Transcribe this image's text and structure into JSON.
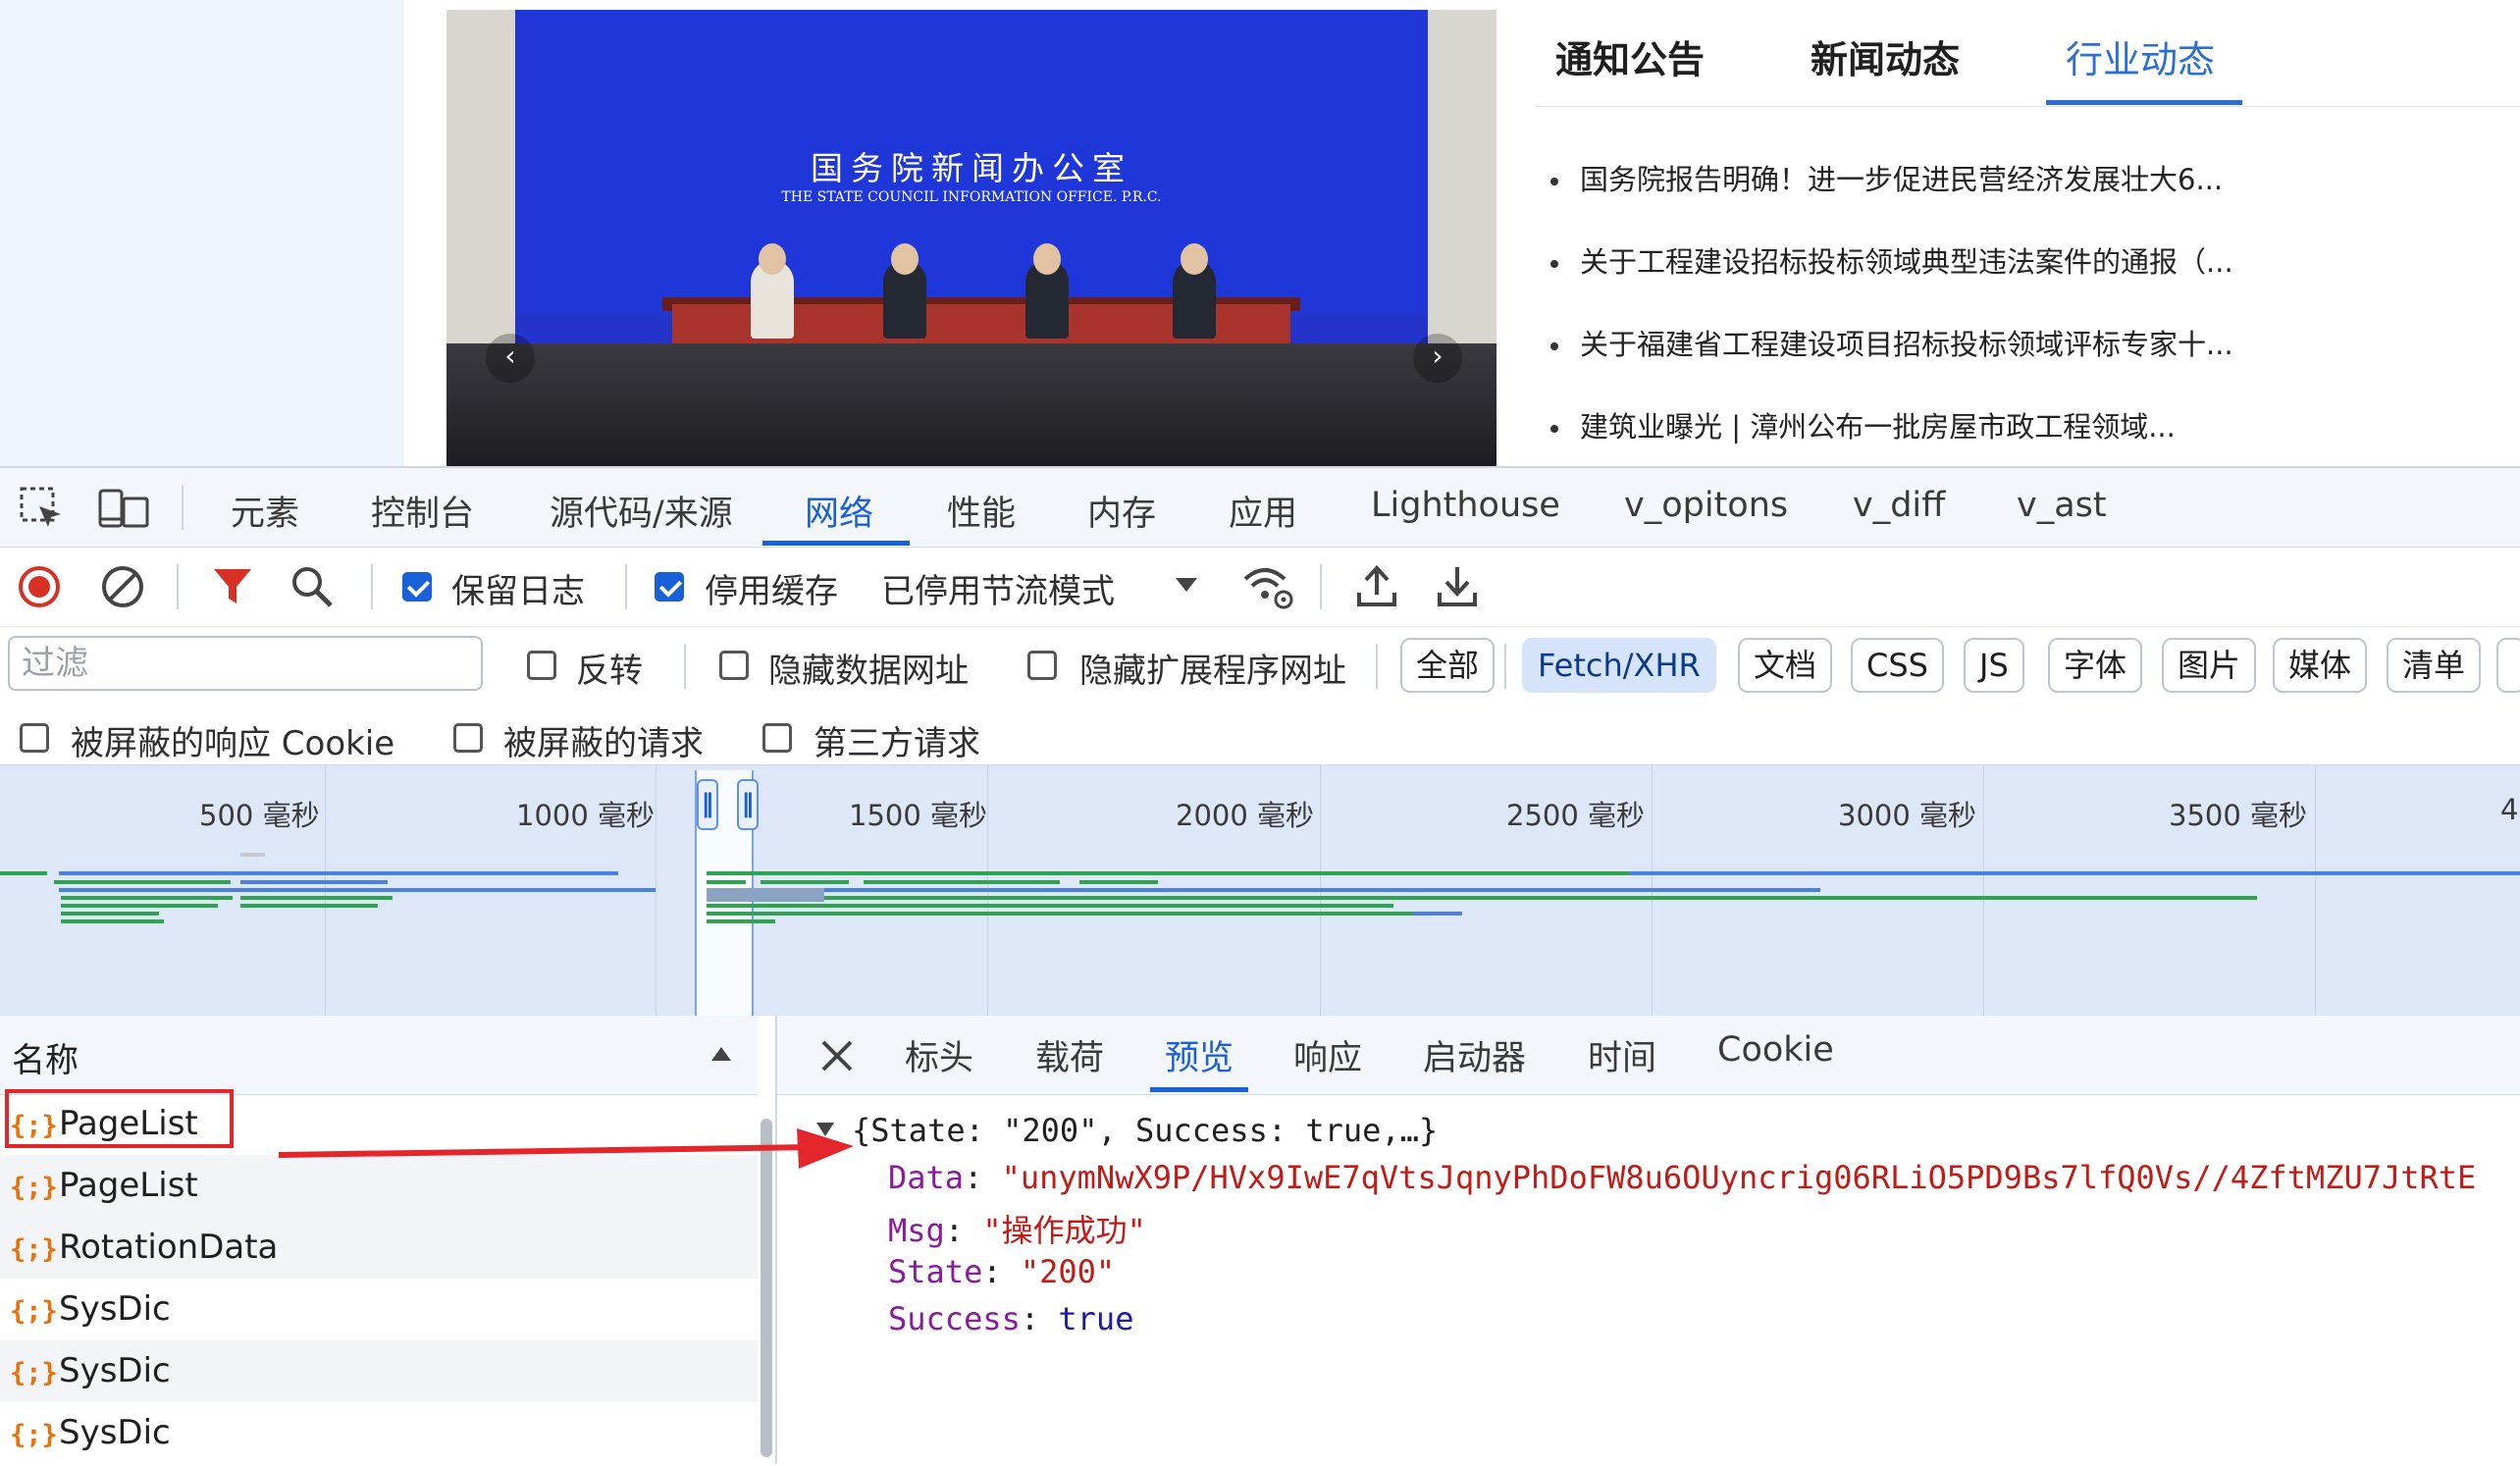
{
  "news": {
    "tabs": [
      "通知公告",
      "新闻动态",
      "行业动态"
    ],
    "active_tab": "行业动态",
    "items": [
      "国务院报告明确！进一步促进民营经济发展壮大6...",
      "关于工程建设招标投标领域典型违法案件的通报（...",
      "关于福建省工程建设项目招标投标领域评标专家十...",
      "建筑业曝光 | 漳州公布一批房屋市政工程领域..."
    ]
  },
  "banner": {
    "title_cn": "国务院新闻办公室",
    "title_en": "THE STATE COUNCIL INFORMATION OFFICE. P.R.C."
  },
  "devtools": {
    "tabs": [
      "元素",
      "控制台",
      "源代码/来源",
      "网络",
      "性能",
      "内存",
      "应用",
      "Lighthouse",
      "v_opitons",
      "v_diff",
      "v_ast"
    ],
    "active_tab": "网络",
    "toolbar": {
      "preserve_log": "保留日志",
      "disable_cache": "停用缓存",
      "throttling": "已停用节流模式"
    },
    "filter": {
      "placeholder": "过滤",
      "invert": "反转",
      "hide_data_urls": "隐藏数据网址",
      "hide_extension_urls": "隐藏扩展程序网址",
      "types": [
        "全部",
        "Fetch/XHR",
        "文档",
        "CSS",
        "JS",
        "字体",
        "图片",
        "媒体",
        "清单"
      ],
      "active_type": "Fetch/XHR",
      "blocked_cookies": "被屏蔽的响应 Cookie",
      "blocked_requests": "被屏蔽的请求",
      "third_party": "第三方请求"
    },
    "timeline_ticks": [
      "500 毫秒",
      "1000 毫秒",
      "1500 毫秒",
      "2000 毫秒",
      "2500 毫秒",
      "3000 毫秒",
      "3500 毫秒",
      "4"
    ],
    "request_list": {
      "header": "名称",
      "rows": [
        "PageList",
        "PageList",
        "RotationData",
        "SysDic",
        "SysDic",
        "SysDic"
      ]
    },
    "detail_tabs": [
      "标头",
      "载荷",
      "预览",
      "响应",
      "启动器",
      "时间",
      "Cookie"
    ],
    "detail_active_tab": "预览",
    "preview": {
      "summary": "{State: \"200\", Success: true,…}",
      "data_key": "Data",
      "data_value": "\"unymNwX9P/HVx9IwE7qVtsJqnyPhDoFW8u6OUyncrig06RLiO5PD9Bs7lfQ0Vs//4ZftMZU7JtRtE",
      "msg_key": "Msg",
      "msg_value": "\"操作成功\"",
      "state_key": "State",
      "state_value": "\"200\"",
      "success_key": "Success",
      "success_value": "true"
    }
  }
}
